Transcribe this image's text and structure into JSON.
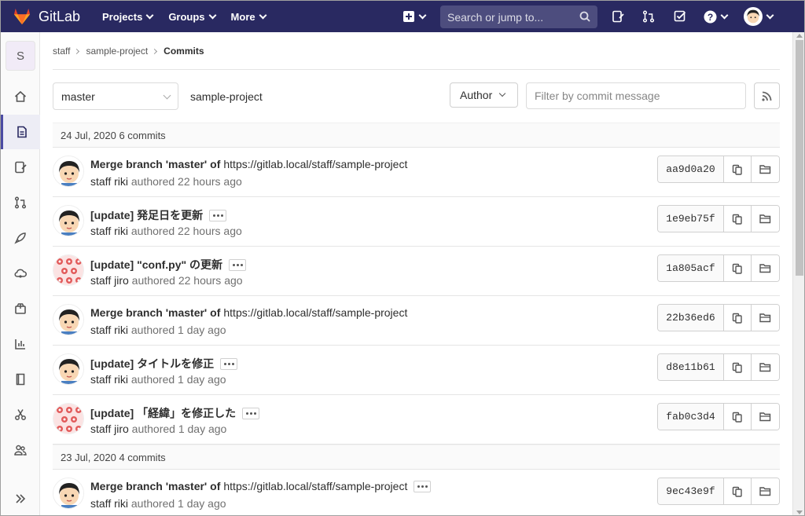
{
  "app": {
    "name": "GitLab"
  },
  "nav": {
    "items": [
      "Projects",
      "Groups",
      "More"
    ],
    "search_placeholder": "Search or jump to..."
  },
  "sidebar": {
    "project_initial": "S",
    "items": [
      "project-overview",
      "repository",
      "issues",
      "merge-requests",
      "ci-cd",
      "operations",
      "packages",
      "analytics",
      "wiki",
      "snippets",
      "members",
      "collapse"
    ]
  },
  "breadcrumb": [
    "staff",
    "sample-project",
    "Commits"
  ],
  "toolbar": {
    "branch": "master",
    "project_path": "sample-project",
    "author_label": "Author",
    "filter_placeholder": "Filter by commit message"
  },
  "days": [
    {
      "label": "24 Jul, 2020 6 commits"
    },
    {
      "label": "23 Jul, 2020 4 commits"
    }
  ],
  "commits": [
    {
      "title": "Merge branch 'master' of",
      "url": "https://gitlab.local/staff/sample-project",
      "author": "staff riki",
      "authored": "authored",
      "time": "22 hours ago",
      "sha": "aa9d0a20",
      "avatar": "boy",
      "ellipsis": false
    },
    {
      "title": "[update] 発足日を更新",
      "url": "",
      "author": "staff riki",
      "authored": "authored",
      "time": "22 hours ago",
      "sha": "1e9eb75f",
      "avatar": "boy",
      "ellipsis": true
    },
    {
      "title": "[update] \"conf.py\" の更新",
      "url": "",
      "author": "staff jiro",
      "authored": "authored",
      "time": "22 hours ago",
      "sha": "1a805acf",
      "avatar": "pattern",
      "ellipsis": true
    },
    {
      "title": "Merge branch 'master' of",
      "url": "https://gitlab.local/staff/sample-project",
      "author": "staff riki",
      "authored": "authored",
      "time": "1 day ago",
      "sha": "22b36ed6",
      "avatar": "boy",
      "ellipsis": false
    },
    {
      "title": "[update] タイトルを修正",
      "url": "",
      "author": "staff riki",
      "authored": "authored",
      "time": "1 day ago",
      "sha": "d8e11b61",
      "avatar": "boy",
      "ellipsis": true
    },
    {
      "title": "[update] 「経緯」を修正した",
      "url": "",
      "author": "staff jiro",
      "authored": "authored",
      "time": "1 day ago",
      "sha": "fab0c3d4",
      "avatar": "pattern",
      "ellipsis": true
    },
    {
      "title": "Merge branch 'master' of",
      "url": "https://gitlab.local/staff/sample-project",
      "author": "staff riki",
      "authored": "authored",
      "time": "1 day ago",
      "sha": "9ec43e9f",
      "avatar": "boy",
      "ellipsis": true
    }
  ],
  "colors": {
    "navbar": "#292961",
    "accent": "#4b4ba3",
    "search_bg": "#4d4d7e"
  }
}
